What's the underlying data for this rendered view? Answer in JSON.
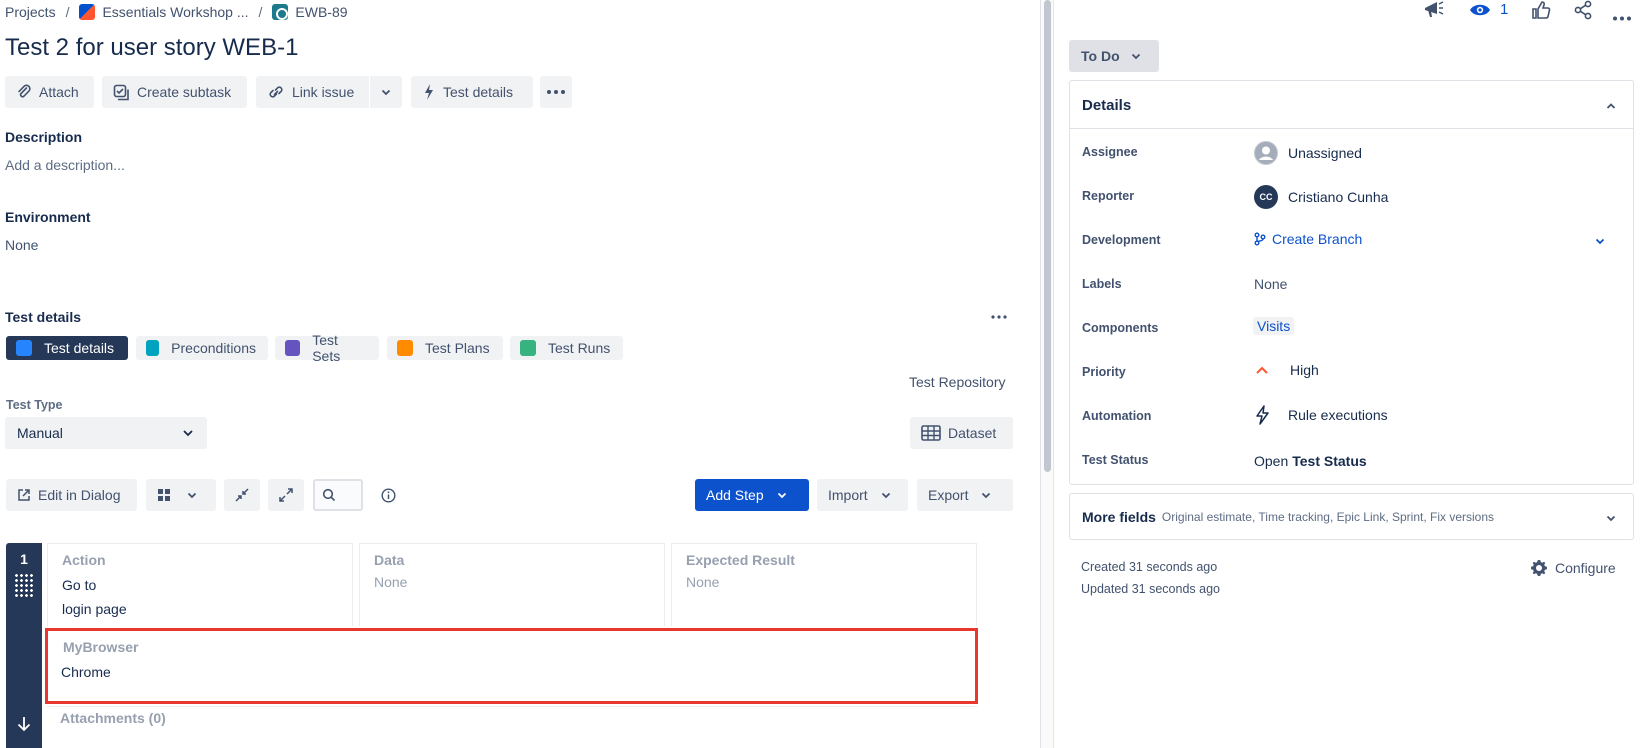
{
  "breadcrumb": {
    "projects": "Projects",
    "project": "Essentials Workshop ...",
    "issue_key": "EWB-89"
  },
  "issue": {
    "title": "Test 2 for user story WEB-1"
  },
  "toolbar": {
    "attach": "Attach",
    "create_subtask": "Create subtask",
    "link_issue": "Link issue",
    "test_details": "Test details"
  },
  "description": {
    "heading": "Description",
    "placeholder": "Add a description..."
  },
  "environment": {
    "heading": "Environment",
    "value": "None"
  },
  "test_details": {
    "heading": "Test details",
    "tabs": [
      {
        "label": "Test details",
        "color": "#2684ff"
      },
      {
        "label": "Preconditions",
        "color": "#00a3bf"
      },
      {
        "label": "Test Sets",
        "color": "#6554c0"
      },
      {
        "label": "Test Plans",
        "color": "#ff8b00"
      },
      {
        "label": "Test Runs",
        "color": "#36b37e"
      }
    ],
    "repository_link": "Test Repository",
    "test_type_label": "Test Type",
    "test_type_value": "Manual",
    "dataset_button": "Dataset",
    "edit_dialog_button": "Edit in Dialog",
    "add_step_button": "Add Step",
    "import_button": "Import",
    "export_button": "Export"
  },
  "steps": [
    {
      "number": "1",
      "action_header": "Action",
      "action_line1": "Go to",
      "action_line2": "login page",
      "data_header": "Data",
      "data_value": "None",
      "expected_header": "Expected Result",
      "expected_value": "None",
      "custom_field_header": "MyBrowser",
      "custom_field_value": "Chrome",
      "attachments": "Attachments (0)"
    }
  ],
  "header_actions": {
    "watch_count": "1"
  },
  "status": {
    "label": "To Do"
  },
  "details": {
    "heading": "Details",
    "fields": [
      {
        "label": "Assignee",
        "value": "Unassigned"
      },
      {
        "label": "Reporter",
        "value": "Cristiano Cunha",
        "initials": "CC"
      },
      {
        "label": "Development",
        "value": "Create Branch"
      },
      {
        "label": "Labels",
        "value": "None"
      },
      {
        "label": "Components",
        "value": "Visits"
      },
      {
        "label": "Priority",
        "value": "High"
      },
      {
        "label": "Automation",
        "value": "Rule executions"
      },
      {
        "label": "Test Status",
        "prefix": "Open",
        "value": "Test Status"
      }
    ]
  },
  "more_fields": {
    "heading": "More fields",
    "hint": "Original estimate, Time tracking, Epic Link, Sprint, Fix versions"
  },
  "meta": {
    "created": "Created 31 seconds ago",
    "updated": "Updated 31 seconds ago",
    "configure": "Configure"
  },
  "colors": {
    "primary": "#0c52cc",
    "dark_rail": "#253858",
    "highlight": "#e8372f",
    "priority_high": "#ff5630"
  }
}
